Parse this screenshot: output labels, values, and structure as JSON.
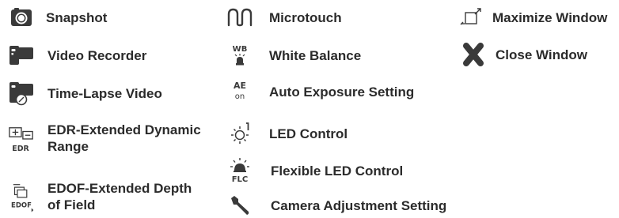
{
  "colors": {
    "icon": "#3a3a3a",
    "text": "#2b2b2b",
    "background": "#ffffff"
  },
  "columns": [
    {
      "items": [
        {
          "icon": "camera-icon",
          "label": "Snapshot"
        },
        {
          "icon": "video-recorder-icon",
          "label": "Video Recorder"
        },
        {
          "icon": "time-lapse-icon",
          "label": "Time-Lapse Video"
        },
        {
          "icon": "edr-icon",
          "icon_text": "EDR",
          "label": "EDR-Extended Dynamic Range"
        },
        {
          "icon": "edof-icon",
          "icon_text": "EDOF",
          "label": "EDOF-Extended Depth of Field"
        }
      ]
    },
    {
      "items": [
        {
          "icon": "microtouch-icon",
          "label": "Microtouch"
        },
        {
          "icon": "white-balance-icon",
          "icon_text": "WB",
          "label": "White Balance"
        },
        {
          "icon": "auto-exposure-icon",
          "icon_text": "AE",
          "icon_subtext": "on",
          "label": "Auto Exposure Setting"
        },
        {
          "icon": "led-control-icon",
          "label": "LED Control"
        },
        {
          "icon": "flexible-led-icon",
          "icon_text": "FLC",
          "label": "Flexible LED Control"
        },
        {
          "icon": "wrench-icon",
          "label": "Camera Adjustment Setting"
        }
      ]
    },
    {
      "items": [
        {
          "icon": "maximize-window-icon",
          "label": "Maximize Window"
        },
        {
          "icon": "close-window-icon",
          "label": "Close Window"
        }
      ]
    }
  ]
}
